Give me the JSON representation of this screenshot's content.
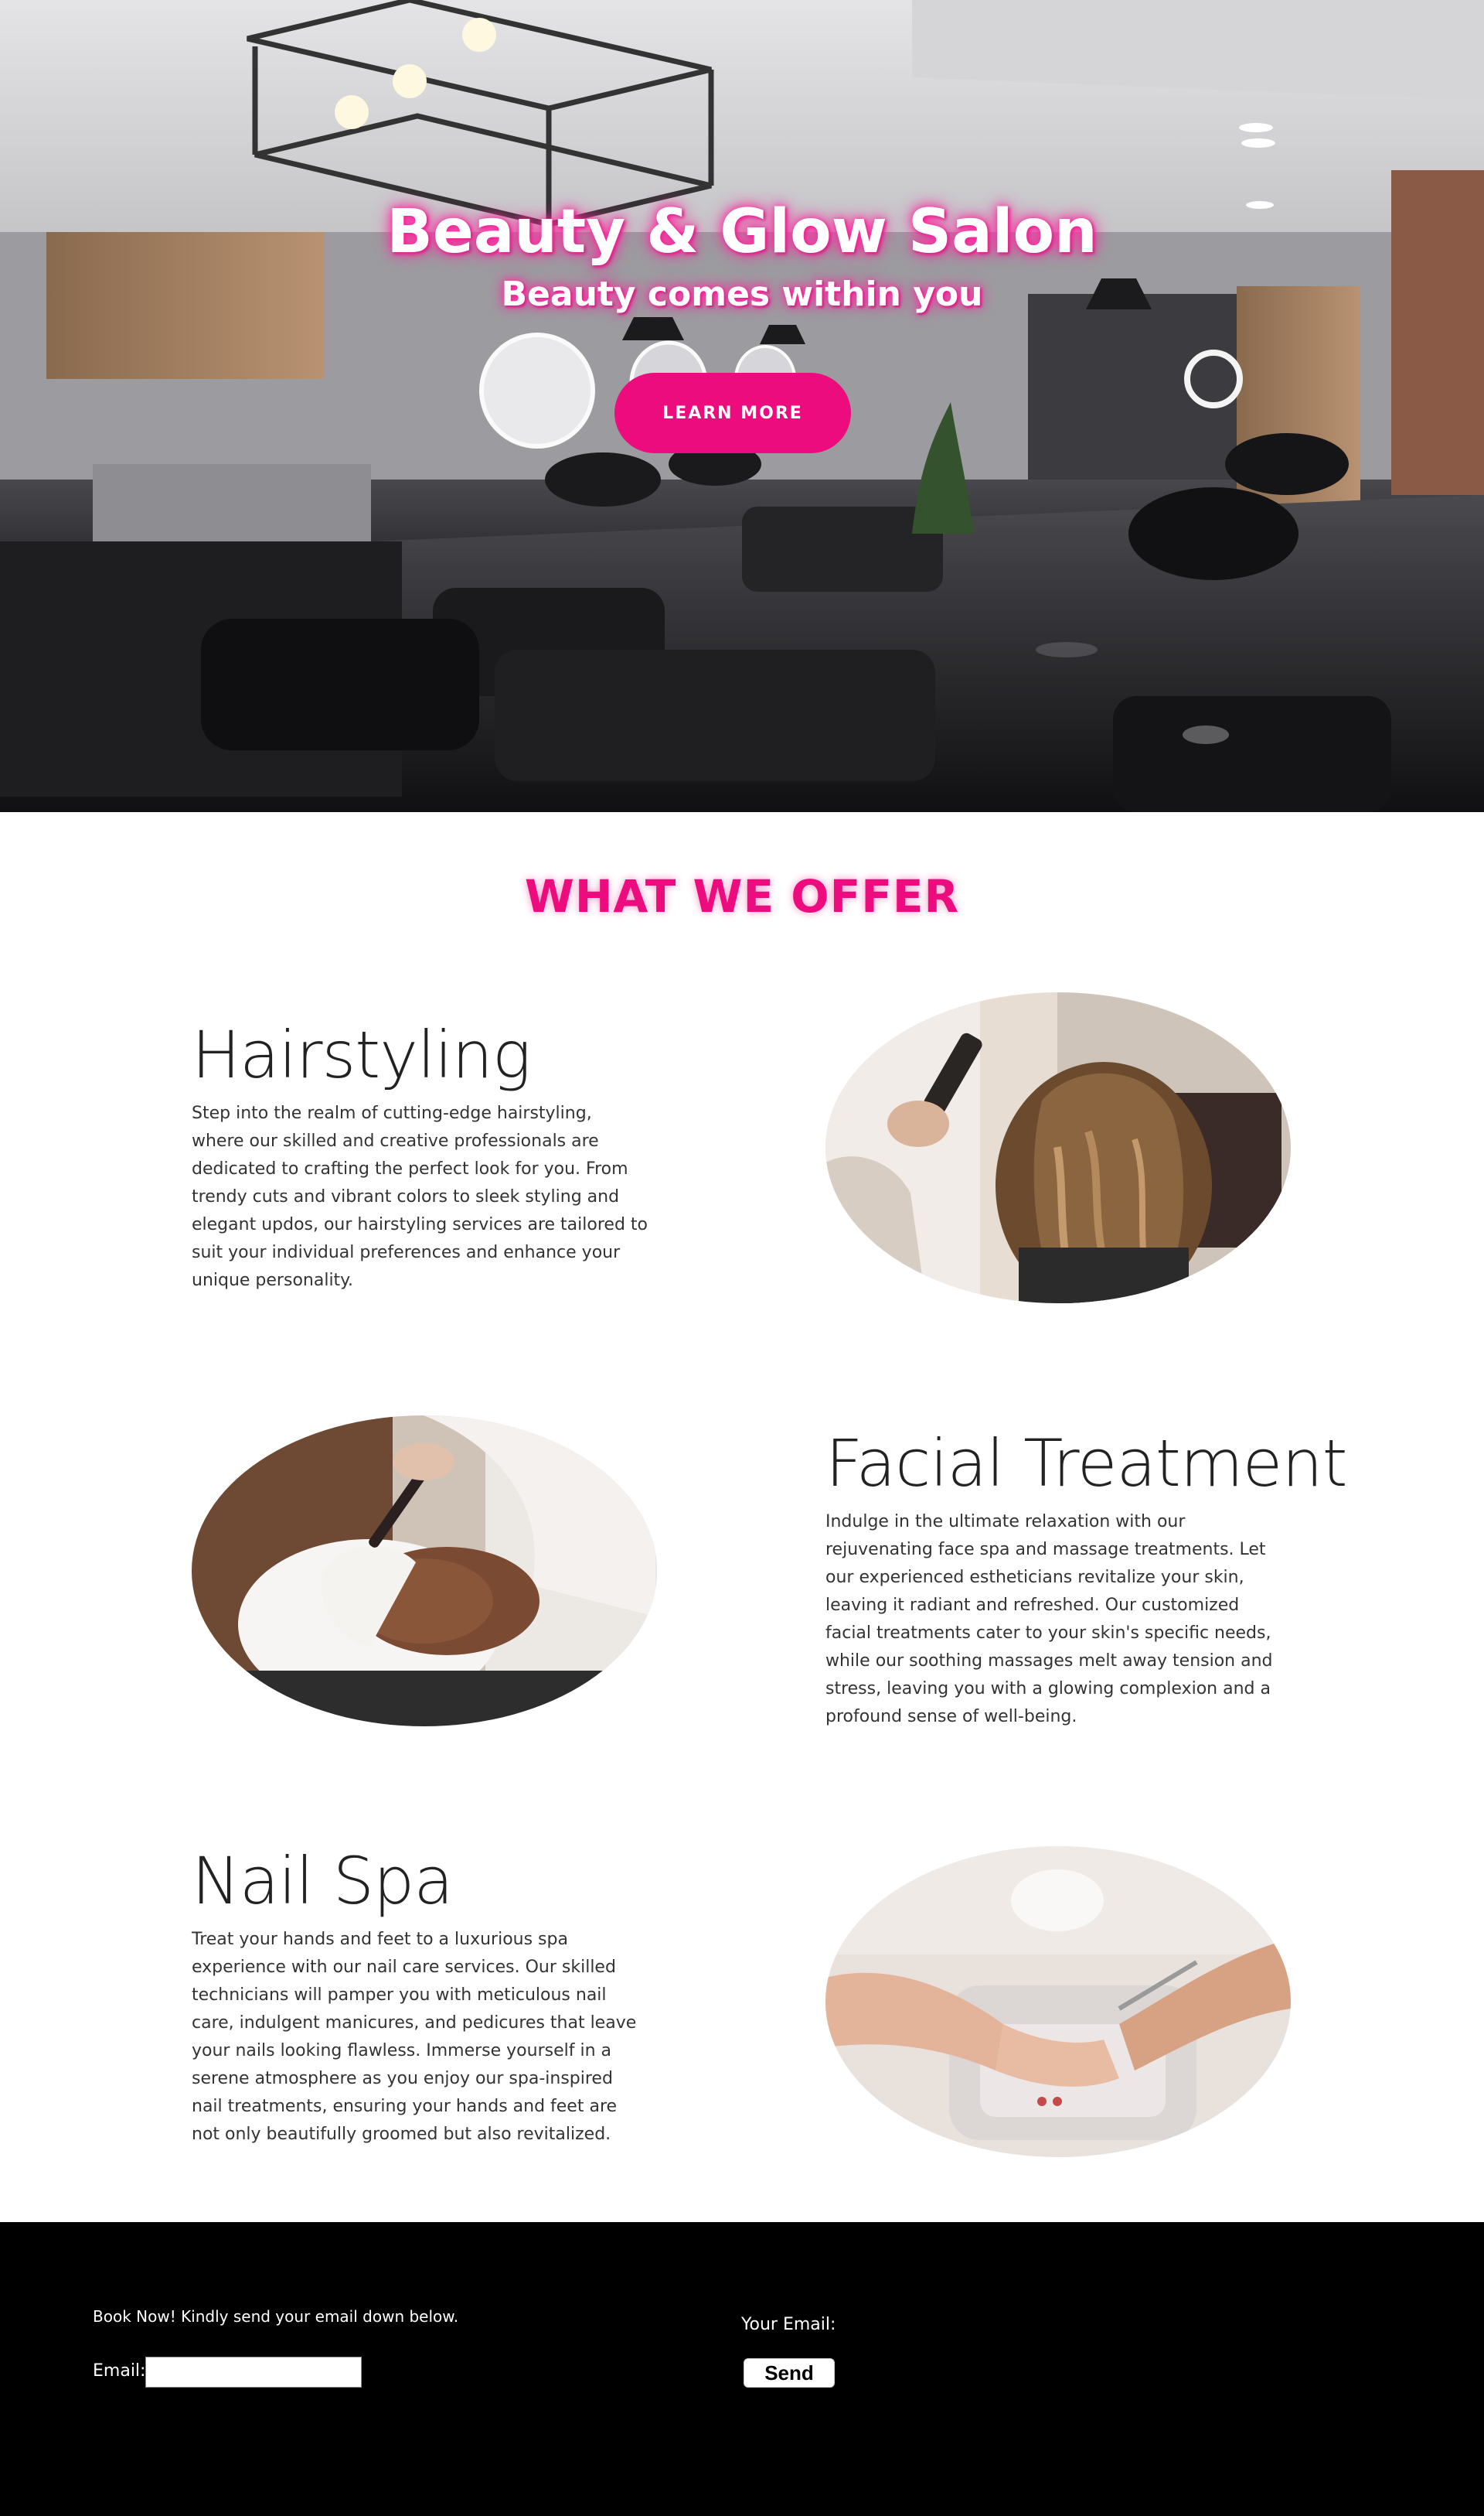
{
  "hero": {
    "title": "Beauty & Glow Salon",
    "subtitle": "Beauty comes within you",
    "button_label": "LEARN MORE",
    "image_name": "salon-interior-image"
  },
  "offer": {
    "heading": "WHAT WE OFFER",
    "services": [
      {
        "title": "Hairstyling",
        "text": "Step into the realm of cutting-edge hairstyling, where our skilled and creative professionals are dedicated to crafting the perfect look for you. From trendy cuts and vibrant colors to sleek styling and elegant updos, our hairstyling services are tailored to suit your individual preferences and enhance your unique personality."
      },
      {
        "title": "Facial Treatment",
        "text": "Indulge in the ultimate relaxation with our rejuvenating face spa and massage treatments. Let our experienced estheticians revitalize your skin, leaving it radiant and refreshed. Our customized facial treatments cater to your skin's specific needs, while our soothing massages melt away tension and stress, leaving you with a glowing complexion and a profound sense of well-being."
      },
      {
        "title": "Nail Spa",
        "text": "Treat your hands and feet to a luxurious spa experience with our nail care services. Our skilled technicians will pamper you with meticulous nail care, indulgent manicures, and pedicures that leave your nails looking flawless. Immerse yourself in a serene atmosphere as you enjoy our spa-inspired nail treatments, ensuring your hands and feet are not only beautifully groomed but also revitalized."
      }
    ]
  },
  "footer": {
    "prompt": "Book Now! Kindly send your email down below.",
    "email_label": "Email:",
    "email_value": "",
    "your_email_label": "Your Email:",
    "send_label": "Send"
  },
  "colors": {
    "accent": "#ec0c7d",
    "footer_bg": "#000000"
  }
}
